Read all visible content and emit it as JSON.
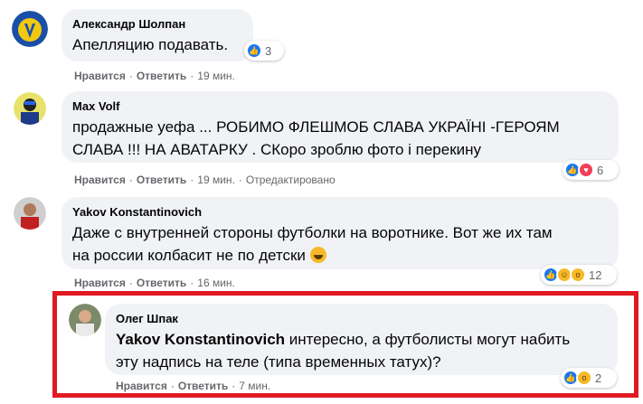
{
  "comments": [
    {
      "author": "Александр Шолпан",
      "text": "Апелляцию подавать.",
      "like": "Нравится",
      "reply": "Ответить",
      "time": "19 мин.",
      "edited": "",
      "reactions_count": "3",
      "reaction_icons": [
        "like-icon"
      ]
    },
    {
      "author": "Max Volf",
      "text_lines": [
        "продажные уефа ... РОБИМО ФЛЕШМОБ СЛАВА УКРАЇНІ -ГЕРОЯМ",
        "СЛАВА !!! НА АВАТАРКУ . СКоро зроблю фото і перекину"
      ],
      "like": "Нравится",
      "reply": "Ответить",
      "time": "19 мин.",
      "edited": "Отредактировано",
      "reactions_count": "6",
      "reaction_icons": [
        "like-icon",
        "love-icon"
      ]
    },
    {
      "author": "Yakov Konstantinovich",
      "text_lines": [
        "Даже с внутренней стороны футболки на воротнике. Вот же их там",
        "на россии колбасит не по детски"
      ],
      "emoji": "laughing-emoji",
      "like": "Нравится",
      "reply": "Ответить",
      "time": "16 мин.",
      "edited": "",
      "reactions_count": "12",
      "reaction_icons": [
        "like-icon",
        "haha-icon",
        "wow-icon"
      ]
    },
    {
      "author": "Олег Шпак",
      "mention": "Yakov Konstantinovich",
      "text_lines": [
        " интересно, а футболисты могут набить",
        "эту надпись на теле (типа временных татух)?"
      ],
      "like": "Нравится",
      "reply": "Ответить",
      "time": "7 мин.",
      "edited": "",
      "reactions_count": "2",
      "reaction_icons": [
        "like-icon",
        "wow-icon"
      ]
    }
  ],
  "colors": {
    "bubble": "#f0f2f5",
    "meta": "#65676b",
    "highlight": "#e01a22",
    "like": "#1877f2",
    "love": "#f33e58",
    "haha": "#f7b928"
  }
}
